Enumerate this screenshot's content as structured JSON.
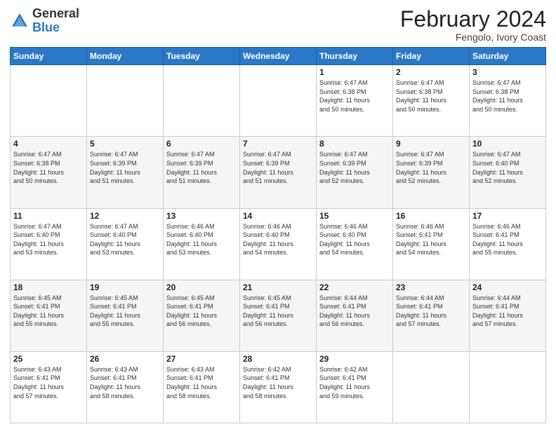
{
  "header": {
    "logo_general": "General",
    "logo_blue": "Blue",
    "month_title": "February 2024",
    "location": "Fengolo, Ivory Coast"
  },
  "weekdays": [
    "Sunday",
    "Monday",
    "Tuesday",
    "Wednesday",
    "Thursday",
    "Friday",
    "Saturday"
  ],
  "weeks": [
    [
      {
        "day": "",
        "info": ""
      },
      {
        "day": "",
        "info": ""
      },
      {
        "day": "",
        "info": ""
      },
      {
        "day": "",
        "info": ""
      },
      {
        "day": "1",
        "info": "Sunrise: 6:47 AM\nSunset: 6:38 PM\nDaylight: 11 hours\nand 50 minutes."
      },
      {
        "day": "2",
        "info": "Sunrise: 6:47 AM\nSunset: 6:38 PM\nDaylight: 11 hours\nand 50 minutes."
      },
      {
        "day": "3",
        "info": "Sunrise: 6:47 AM\nSunset: 6:38 PM\nDaylight: 11 hours\nand 50 minutes."
      }
    ],
    [
      {
        "day": "4",
        "info": "Sunrise: 6:47 AM\nSunset: 6:38 PM\nDaylight: 11 hours\nand 50 minutes."
      },
      {
        "day": "5",
        "info": "Sunrise: 6:47 AM\nSunset: 6:39 PM\nDaylight: 11 hours\nand 51 minutes."
      },
      {
        "day": "6",
        "info": "Sunrise: 6:47 AM\nSunset: 6:39 PM\nDaylight: 11 hours\nand 51 minutes."
      },
      {
        "day": "7",
        "info": "Sunrise: 6:47 AM\nSunset: 6:39 PM\nDaylight: 11 hours\nand 51 minutes."
      },
      {
        "day": "8",
        "info": "Sunrise: 6:47 AM\nSunset: 6:39 PM\nDaylight: 11 hours\nand 52 minutes."
      },
      {
        "day": "9",
        "info": "Sunrise: 6:47 AM\nSunset: 6:39 PM\nDaylight: 11 hours\nand 52 minutes."
      },
      {
        "day": "10",
        "info": "Sunrise: 6:47 AM\nSunset: 6:40 PM\nDaylight: 11 hours\nand 52 minutes."
      }
    ],
    [
      {
        "day": "11",
        "info": "Sunrise: 6:47 AM\nSunset: 6:40 PM\nDaylight: 11 hours\nand 53 minutes."
      },
      {
        "day": "12",
        "info": "Sunrise: 6:47 AM\nSunset: 6:40 PM\nDaylight: 11 hours\nand 53 minutes."
      },
      {
        "day": "13",
        "info": "Sunrise: 6:46 AM\nSunset: 6:40 PM\nDaylight: 11 hours\nand 53 minutes."
      },
      {
        "day": "14",
        "info": "Sunrise: 6:46 AM\nSunset: 6:40 PM\nDaylight: 11 hours\nand 54 minutes."
      },
      {
        "day": "15",
        "info": "Sunrise: 6:46 AM\nSunset: 6:40 PM\nDaylight: 11 hours\nand 54 minutes."
      },
      {
        "day": "16",
        "info": "Sunrise: 6:46 AM\nSunset: 6:41 PM\nDaylight: 11 hours\nand 54 minutes."
      },
      {
        "day": "17",
        "info": "Sunrise: 6:46 AM\nSunset: 6:41 PM\nDaylight: 11 hours\nand 55 minutes."
      }
    ],
    [
      {
        "day": "18",
        "info": "Sunrise: 6:45 AM\nSunset: 6:41 PM\nDaylight: 11 hours\nand 55 minutes."
      },
      {
        "day": "19",
        "info": "Sunrise: 6:45 AM\nSunset: 6:41 PM\nDaylight: 11 hours\nand 55 minutes."
      },
      {
        "day": "20",
        "info": "Sunrise: 6:45 AM\nSunset: 6:41 PM\nDaylight: 11 hours\nand 56 minutes."
      },
      {
        "day": "21",
        "info": "Sunrise: 6:45 AM\nSunset: 6:41 PM\nDaylight: 11 hours\nand 56 minutes."
      },
      {
        "day": "22",
        "info": "Sunrise: 6:44 AM\nSunset: 6:41 PM\nDaylight: 11 hours\nand 56 minutes."
      },
      {
        "day": "23",
        "info": "Sunrise: 6:44 AM\nSunset: 6:41 PM\nDaylight: 11 hours\nand 57 minutes."
      },
      {
        "day": "24",
        "info": "Sunrise: 6:44 AM\nSunset: 6:41 PM\nDaylight: 11 hours\nand 57 minutes."
      }
    ],
    [
      {
        "day": "25",
        "info": "Sunrise: 6:43 AM\nSunset: 6:41 PM\nDaylight: 11 hours\nand 57 minutes."
      },
      {
        "day": "26",
        "info": "Sunrise: 6:43 AM\nSunset: 6:41 PM\nDaylight: 11 hours\nand 58 minutes."
      },
      {
        "day": "27",
        "info": "Sunrise: 6:43 AM\nSunset: 6:41 PM\nDaylight: 11 hours\nand 58 minutes."
      },
      {
        "day": "28",
        "info": "Sunrise: 6:42 AM\nSunset: 6:41 PM\nDaylight: 11 hours\nand 58 minutes."
      },
      {
        "day": "29",
        "info": "Sunrise: 6:42 AM\nSunset: 6:41 PM\nDaylight: 11 hours\nand 59 minutes."
      },
      {
        "day": "",
        "info": ""
      },
      {
        "day": "",
        "info": ""
      }
    ]
  ]
}
